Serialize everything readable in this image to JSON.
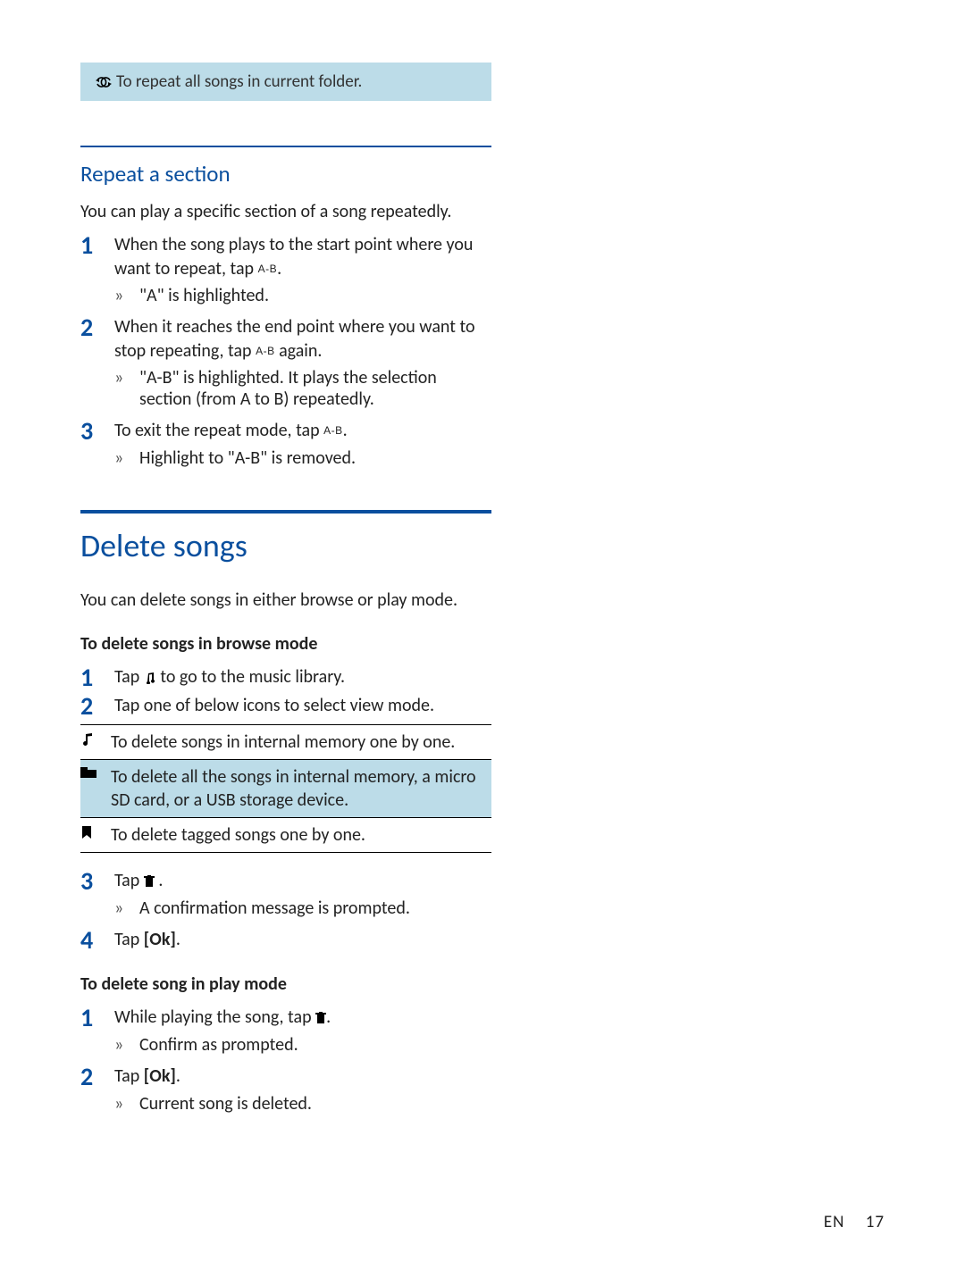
{
  "callout": {
    "text": "To repeat all songs in current folder."
  },
  "repeat_section": {
    "heading": "Repeat a section",
    "intro": "You can play a specific section of a song repeatedly.",
    "step1": "When the song plays to the start point where you want to repeat, tap ",
    "ab_label": "A-B",
    "step1_suffix": ".",
    "step1_result": "\"A\" is highlighted.",
    "step2": "When it reaches the end point where you want to stop repeating, tap ",
    "step2_suffix": " again.",
    "step2_result": "\"A-B\" is highlighted. It plays the selection section (from A to B) repeatedly.",
    "step3": "To exit the repeat mode, tap ",
    "step3_suffix": ".",
    "step3_result": "Highlight to \"A-B\" is removed."
  },
  "delete": {
    "heading": "Delete songs",
    "intro": "You can delete songs in either browse or play mode.",
    "browse_heading": "To delete songs in browse mode",
    "b1_a": "Tap ",
    "b1_b": " to go to the music library.",
    "b2": "Tap one of below icons to select view mode.",
    "table": {
      "row1": "To delete songs in internal memory one by one.",
      "row2": "To delete all the songs in internal memory, a micro SD card, or a USB storage device.",
      "row3": "To delete tagged songs one by one."
    },
    "b3_a": "Tap ",
    "b3_b": " .",
    "b3_result": "A confirmation message is prompted.",
    "b4_a": "Tap ",
    "ok_label": "[Ok]",
    "b4_b": ".",
    "play_heading": "To delete song in play mode",
    "p1_a": "While playing the song, tap ",
    "p1_b": ".",
    "p1_result": "Confirm as prompted.",
    "p2_a": "Tap ",
    "p2_b": ".",
    "p2_result": "Current song is deleted."
  },
  "footer": {
    "lang": "EN",
    "page": "17"
  }
}
